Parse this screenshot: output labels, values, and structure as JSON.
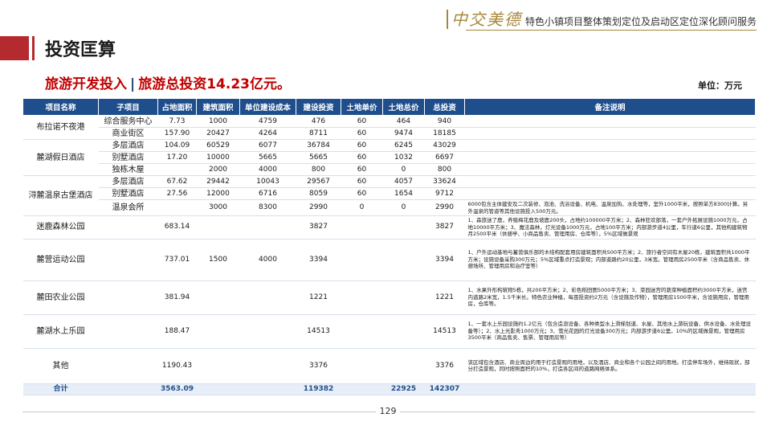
{
  "header": {
    "logo_text": "中交美德",
    "service": "特色小镇项目整体策划定位及启动区定位深化顾问服务"
  },
  "page_title": "投资匡算",
  "subtitle": {
    "part1": "旅游开发投入",
    "separator": "|",
    "part2": "旅游总投资14.23亿元。"
  },
  "unit": "单位：万元",
  "table": {
    "headers": [
      "项目名称",
      "子项目",
      "占地面积",
      "建筑面积",
      "单位建设成本",
      "建设投资",
      "土地单价",
      "土地总价",
      "总投资",
      "备注说明"
    ],
    "groups": [
      {
        "name": "布拉诺不夜港",
        "rows": [
          [
            "综合服务中心",
            "7.73",
            "1000",
            "4759",
            "476",
            "60",
            "464",
            "940",
            ""
          ],
          [
            "商业街区",
            "157.90",
            "20427",
            "4264",
            "8711",
            "60",
            "9474",
            "18185",
            ""
          ]
        ]
      },
      {
        "name": "麓湖假日酒店",
        "rows": [
          [
            "多层酒店",
            "104.09",
            "60529",
            "6077",
            "36784",
            "60",
            "6245",
            "43029",
            ""
          ],
          [
            "别墅酒店",
            "17.20",
            "10000",
            "5665",
            "5665",
            "60",
            "1032",
            "6697",
            ""
          ],
          [
            "独栋木屋",
            "",
            "2000",
            "4000",
            "800",
            "60",
            "0",
            "800",
            ""
          ]
        ]
      },
      {
        "name": "浔麓温泉古堡酒店",
        "rows": [
          [
            "多层酒店",
            "67.62",
            "29442",
            "10043",
            "29567",
            "60",
            "4057",
            "33624",
            ""
          ],
          [
            "别墅酒店",
            "27.56",
            "12000",
            "6716",
            "8059",
            "60",
            "1654",
            "9712",
            ""
          ],
          [
            "温泉会所",
            "",
            "3000",
            "8300",
            "2990",
            "0",
            "0",
            "2990",
            "6000包含主体建安及二次装修、泡池、洗浴设备、机电、温泉加热、水处理等，室外1000平米，按照单方8300计算。另外温泉的管道等其他设施投入500万元。"
          ]
        ]
      },
      {
        "name": "迷鹿森林公园",
        "rows": [
          [
            "",
            "683.14",
            "",
            "",
            "3827",
            "",
            "",
            "3827",
            "1、森旅迷了鹿，养殖梅花鹿及坡鹿200头，占地约100000平方米；2、森林狂欢部落，一套户外拓展设施1000万元，占地10000平方米；3、魔法森林，灯光设备1000万元，占地100平方米；内部游步道4公里，车行道6公里，其他构建筑物月2500平米（休憩亭、小商品售卖、管理用房、仓库等），5%区域做景观"
          ]
        ]
      },
      {
        "name": "麓营运动公园",
        "rows": [
          [
            "",
            "737.01",
            "1500",
            "4000",
            "3394",
            "",
            "",
            "3394",
            "1、户外运动基地与蓄营俱乐部的木结构配套用房建筑面积共500平方米；2、旅行者空间有木屋20栋，建筑面积共1000平方米；设施设备采购300万元；5%区域重点打造景观；内部道路约20公里，3米宽。管理用房2500平米（含商品售卖、休憩场所、管理用房和治疗室等）"
          ]
        ]
      },
      {
        "name": "麓田农业公园",
        "rows": [
          [
            "",
            "381.94",
            "",
            "",
            "1221",
            "",
            "",
            "1221",
            "1、水果外形构筑物5栋，共200平方米；2、彩色稻田图5000平方米；3、菜园迷宫的蔬菜种植面积约3000平方米，迷宫内道路2米宽，1.5千米长。特色农业种植，每亩投资约2万元（含设施及作物），管理用房1500平米，含设施用房，管理用房，仓库等。"
          ]
        ]
      },
      {
        "name": "麓湖水上乐园",
        "rows": [
          [
            "",
            "188.47",
            "",
            "",
            "14513",
            "",
            "",
            "14513",
            "1、一套水上乐园设施约1.2亿元（包含造浪设备、各种类型水上滑梯划道、水屋、其他水上游玩设备、供水设备、水处理设备等）；2、水上光影秀1000万元；3、萤光花园的灯光设备300万元；内部游步道6公里。10%的区域做景观，管理用房3500平米（商品售卖、售票、管理用房等）"
          ]
        ]
      },
      {
        "name": "其他",
        "rows": [
          [
            "",
            "1190.43",
            "",
            "",
            "3376",
            "",
            "",
            "3376",
            "该区域包含酒店、商业周边的用于打造景观的用地，以及酒店、商业和各个公园之间的用地。打造停车场外，维持现状，部分打造景观，同时按照面积的10%，打造各区间的道路网络体系。"
          ]
        ]
      }
    ],
    "total": {
      "label": "合计",
      "land_area": "3563.09",
      "build_invest": "119382",
      "land_total": "22925",
      "total_invest": "142307"
    }
  },
  "page_number": "129"
}
